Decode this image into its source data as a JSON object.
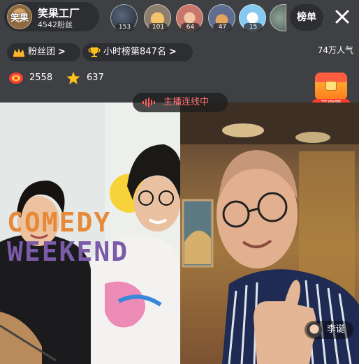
{
  "host": {
    "avatar_text": "笑果",
    "name": "笑果工厂",
    "fans": "4542粉丝"
  },
  "viewers": [
    {
      "badge": "153"
    },
    {
      "badge": "101"
    },
    {
      "badge": "64"
    },
    {
      "badge": "47"
    },
    {
      "badge": "15"
    }
  ],
  "header": {
    "rank_label": "榜单",
    "close_icon": "close-icon"
  },
  "row2": {
    "fan_group": "粉丝团",
    "hour_rank": "小时榜第847名",
    "chevron": ">",
    "popularity": "74万人气"
  },
  "stats": {
    "coins": "2558",
    "stars": "637"
  },
  "treasure": {
    "label": "开宝箱"
  },
  "link_status": {
    "label": "主播连线中"
  },
  "stream": {
    "comedy_line1": "COMEDY",
    "comedy_line2": "WEEKEND"
  },
  "guest": {
    "name": "李诞"
  },
  "colors": {
    "status_text": "#ff7272",
    "treasure_label_bg": "#ff3d2e",
    "star": "#ffc21a",
    "crown": "#ffb52e"
  }
}
